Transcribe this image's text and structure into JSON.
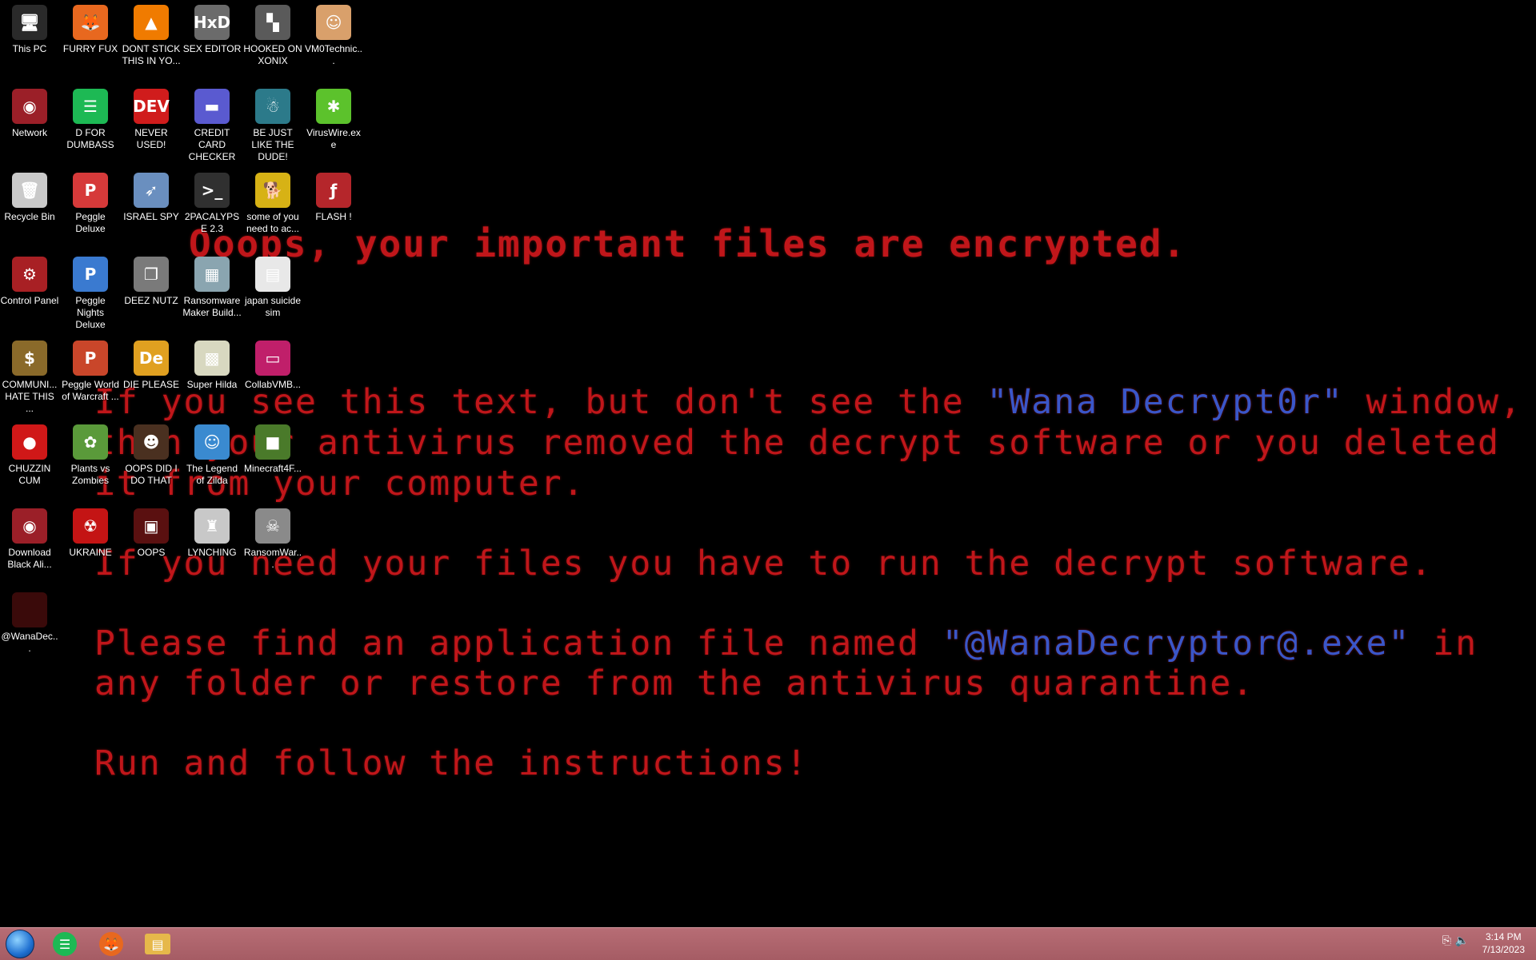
{
  "wallpaper": {
    "title": "Ooops, your important files are encrypted.",
    "line1_a": "If you see this text, but don't see the ",
    "line1_hl": "\"Wana Decrypt0r\"",
    "line1_b": " window,",
    "line2": "then your antivirus removed the decrypt software or you deleted",
    "line3": "it from your computer.",
    "line4": "If you need your files you have to run the decrypt software.",
    "line5_a": "Please find an application file named ",
    "line5_hl": "\"@WanaDecryptor@.exe\"",
    "line5_b": " in",
    "line6": "any folder or restore from the antivirus quarantine.",
    "line7": "Run and follow the instructions!",
    "text_color": "#c0161a",
    "highlight_color": "#3a56c8"
  },
  "icons": [
    {
      "label": "This PC",
      "glyph": "🖥",
      "color": "#2a2a2a"
    },
    {
      "label": "FURRY FUX",
      "glyph": "🦊",
      "color": "#e8681f"
    },
    {
      "label": "DONT STICK THIS IN YO...",
      "glyph": "▲",
      "color": "#f07b00"
    },
    {
      "label": "SEX EDITOR",
      "glyph": "HxD",
      "color": "#6b6b6b"
    },
    {
      "label": "HOOKED ON XONIX",
      "glyph": "▚",
      "color": "#5a5a5a"
    },
    {
      "label": "VM0Technic...",
      "glyph": "☺",
      "color": "#d9a06b"
    },
    {
      "label": "Network",
      "glyph": "◉",
      "color": "#9b1f28"
    },
    {
      "label": "D FOR DUMBASS",
      "glyph": "☰",
      "color": "#1db954"
    },
    {
      "label": "NEVER USED!",
      "glyph": "DEV",
      "color": "#d01c1c"
    },
    {
      "label": "CREDIT CARD CHECKER",
      "glyph": "▬",
      "color": "#5a5ad0"
    },
    {
      "label": "BE JUST LIKE THE DUDE!",
      "glyph": "☃",
      "color": "#2c7a8a"
    },
    {
      "label": "VirusWire.exe",
      "glyph": "✱",
      "color": "#5cc22c"
    },
    {
      "label": "Recycle Bin",
      "glyph": "🗑",
      "color": "#c9c9c9"
    },
    {
      "label": "Peggle Deluxe",
      "glyph": "P",
      "color": "#d63a3a"
    },
    {
      "label": "ISRAEL SPY",
      "glyph": "➶",
      "color": "#6a8fbf"
    },
    {
      "label": "2PACALYPSE 2.3",
      "glyph": ">_",
      "color": "#303030"
    },
    {
      "label": "some of you need to ac...",
      "glyph": "🐕",
      "color": "#d7b215"
    },
    {
      "label": "FLASH !",
      "glyph": "ƒ",
      "color": "#b5262b"
    },
    {
      "label": "Control Panel",
      "glyph": "⚙",
      "color": "#a82024"
    },
    {
      "label": "Peggle Nights Deluxe",
      "glyph": "P",
      "color": "#3a7ad0"
    },
    {
      "label": "DEEZ NUTZ",
      "glyph": "❐",
      "color": "#7a7a7a"
    },
    {
      "label": "Ransomware Maker Build...",
      "glyph": "▦",
      "color": "#8aa5b0"
    },
    {
      "label": "japan suicide sim",
      "glyph": "▤",
      "color": "#e8e8e8"
    },
    {
      "label": "COMMUNI... HATE THIS ...",
      "glyph": "$",
      "color": "#8a6a2a"
    },
    {
      "label": "Peggle World of Warcraft ...",
      "glyph": "P",
      "color": "#c9462a"
    },
    {
      "label": "DIE PLEASE",
      "glyph": "De",
      "color": "#e0a020"
    },
    {
      "label": "Super Hilda",
      "glyph": "▩",
      "color": "#d8d8c0"
    },
    {
      "label": "CollabVMB...",
      "glyph": "▭",
      "color": "#c01f6a"
    },
    {
      "label": "CHUZZIN CUM",
      "glyph": "●",
      "color": "#d01818"
    },
    {
      "label": "Plants vs Zombies",
      "glyph": "✿",
      "color": "#5a9a3a"
    },
    {
      "label": "OOPS DID I DO THAT",
      "glyph": "☻",
      "color": "#4a3020"
    },
    {
      "label": "The Legend of Zilda",
      "glyph": "☺",
      "color": "#3a8ad0"
    },
    {
      "label": "Minecraft4F...",
      "glyph": "■",
      "color": "#4a7a2a"
    },
    {
      "label": "Download Black Ali...",
      "glyph": "◉",
      "color": "#9b1f28"
    },
    {
      "label": "UKRAINE",
      "glyph": "☢",
      "color": "#c41414"
    },
    {
      "label": "OOPS",
      "glyph": "▣",
      "color": "#5a1010"
    },
    {
      "label": "LYNCHING",
      "glyph": "♜",
      "color": "#c8c8c8"
    },
    {
      "label": "RansomWar...",
      "glyph": "☠",
      "color": "#8a8a8a"
    },
    {
      "label": "@WanaDec...",
      "glyph": "",
      "color": "#3a0a0a"
    }
  ],
  "taskbar": {
    "start_label": "Start",
    "apps": [
      {
        "name": "spotify",
        "glyph": "☰",
        "color": "#1db954"
      },
      {
        "name": "firefox",
        "glyph": "🦊",
        "color": "#e8681f"
      },
      {
        "name": "file-explorer",
        "glyph": "▤",
        "color": "#e6b84a"
      }
    ],
    "time": "3:14 PM",
    "date": "7/13/2023",
    "color": "#b0656d"
  }
}
